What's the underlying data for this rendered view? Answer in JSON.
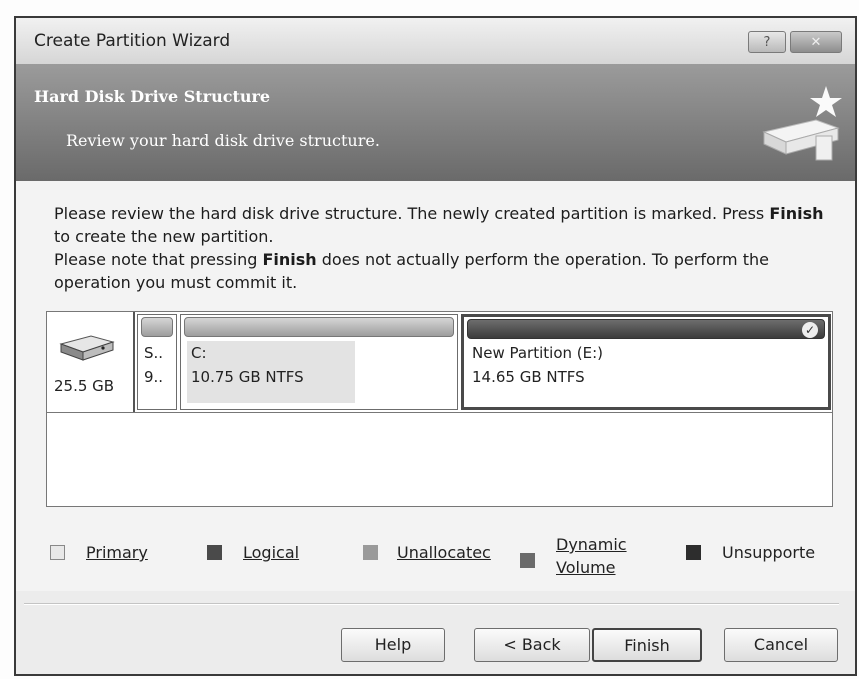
{
  "window": {
    "title": "Create Partition Wizard",
    "help_button": "?",
    "close_button": "✕"
  },
  "header": {
    "title": "Hard Disk Drive Structure",
    "subtitle": "Review your hard disk drive structure."
  },
  "intro": {
    "line1_a": "Please review the hard disk drive structure. The newly created partition is marked. Press ",
    "line1_bold": "Finish",
    "line1_b": " to create the new partition.",
    "line2_a": "Please note that pressing ",
    "line2_bold": "Finish",
    "line2_b": " does not actually perform the operation. To perform the operation you must commit it."
  },
  "disk": {
    "size": "25.5 GB",
    "icon": "hard-disk-icon",
    "partitions": [
      {
        "name": "S..",
        "detail": "9..",
        "selected": false
      },
      {
        "name": "C:",
        "detail": "10.75 GB  NTFS",
        "selected": false
      },
      {
        "name": "New Partition (E:)",
        "detail": "14.65 GB  NTFS",
        "selected": true
      }
    ]
  },
  "legend": [
    {
      "label": "Primary",
      "color": "#cfcfcf"
    },
    {
      "label": "Logical",
      "color": "#4a4a4a"
    },
    {
      "label": "Unallocatec",
      "color": "#9a9a9a"
    },
    {
      "label": "Dynamic Volume",
      "color": "#6a6a6a"
    },
    {
      "label": "Unsupporte",
      "color": "#2d2d2d"
    }
  ],
  "buttons": {
    "help": "Help",
    "back": "< Back",
    "finish": "Finish",
    "cancel": "Cancel"
  }
}
